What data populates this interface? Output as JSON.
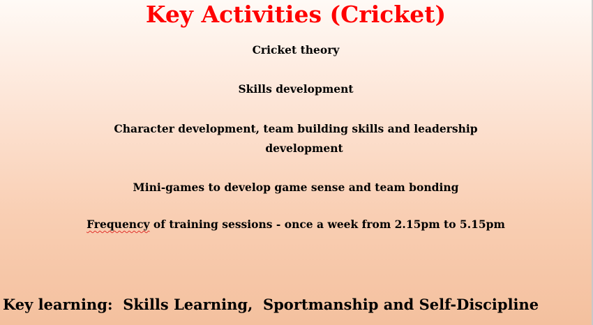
{
  "slide": {
    "title": "Key Activities (Cricket)",
    "items": [
      "Cricket theory",
      "Skills development",
      "Character development, team building skills and leadership",
      "development",
      "Mini-games to develop game sense and team bonding"
    ],
    "frequency": {
      "misspelled_word": "Frequency",
      "rest": " of training sessions - once a week from 2.15pm to 5.15pm"
    },
    "key_learning": {
      "label": "Key learning:",
      "text": "  Skills Learning,  Sportmanship and Self-Discipline"
    }
  },
  "colors": {
    "title": "#ff0000",
    "text": "#000000",
    "background_top": "#fffaf6",
    "background_bottom": "#f4c09e",
    "spellcheck_underline": "#e0302a"
  }
}
